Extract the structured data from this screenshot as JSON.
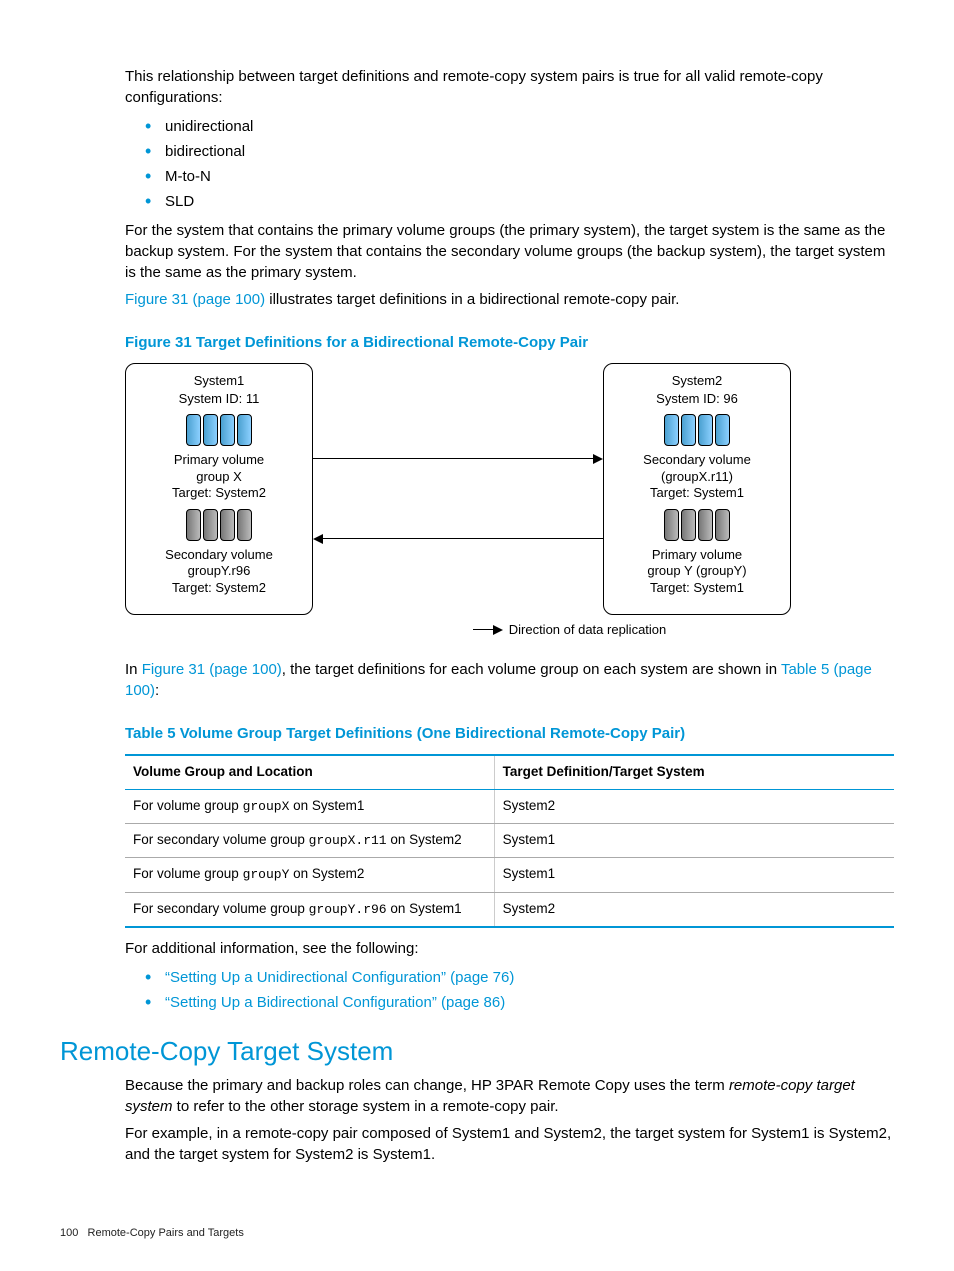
{
  "intro_para": "This relationship between target definitions and remote-copy system pairs is true for all valid remote-copy configurations:",
  "config_list": [
    "unidirectional",
    "bidirectional",
    "M-to-N",
    "SLD"
  ],
  "para2": "For the system that contains the primary volume groups (the primary system), the target system is the same as the backup system. For the system that contains the secondary volume groups (the backup system), the target system is the same as the primary system.",
  "para3_link": "Figure 31 (page 100)",
  "para3_rest": " illustrates target definitions in a bidirectional remote-copy pair.",
  "figure_caption": "Figure 31 Target Definitions for a Bidirectional Remote-Copy Pair",
  "diagram": {
    "left": {
      "name": "System1",
      "id": "System ID: 11",
      "vg1": {
        "l1": "Primary volume",
        "l2": "group X",
        "l3": "Target: System2",
        "color": "blue"
      },
      "vg2": {
        "l1": "Secondary volume",
        "l2": "groupY.r96",
        "l3": "Target: System2",
        "color": "grey"
      }
    },
    "right": {
      "name": "System2",
      "id": "System ID: 96",
      "vg1": {
        "l1": "Secondary volume",
        "l2": "(groupX.r11)",
        "l3": "Target: System1",
        "color": "blue"
      },
      "vg2": {
        "l1": "Primary volume",
        "l2": "group Y (groupY)",
        "l3": "Target: System1",
        "color": "grey"
      }
    },
    "legend": "Direction of data replication"
  },
  "para4_pre": "In ",
  "para4_link1": "Figure 31 (page 100)",
  "para4_mid": ", the target definitions for each volume group on each system are shown in ",
  "para4_link2": "Table 5 (page 100)",
  "para4_post": ":",
  "table_caption": "Table 5 Volume Group Target Definitions (One Bidirectional Remote-Copy Pair)",
  "table": {
    "h1": "Volume Group and Location",
    "h2": "Target Definition/Target System",
    "rows": [
      {
        "c1_pre": "For volume group ",
        "c1_code": "groupX",
        "c1_post": " on System1",
        "c2": "System2"
      },
      {
        "c1_pre": "For secondary volume group ",
        "c1_code": "groupX.r11",
        "c1_post": " on System2",
        "c2": "System1"
      },
      {
        "c1_pre": "For volume group ",
        "c1_code": "groupY",
        "c1_post": " on System2",
        "c2": "System1"
      },
      {
        "c1_pre": "For secondary volume group ",
        "c1_code": "groupY.r96",
        "c1_post": " on System1",
        "c2": "System2"
      }
    ]
  },
  "additional_info": "For additional information, see the following:",
  "see_links": [
    "“Setting Up a Unidirectional Configuration” (page 76)",
    "“Setting Up a Bidirectional Configuration” (page 86)"
  ],
  "h2": "Remote-Copy Target System",
  "para5_pre": "Because the primary and backup roles can change, HP 3PAR Remote Copy uses the term ",
  "para5_em": "remote-copy target system",
  "para5_post": " to refer to the other storage system in a remote-copy pair.",
  "para6": "For example, in a remote-copy pair composed of System1 and System2, the target system for System1 is System2, and the target system for System2 is System1.",
  "footer_page": "100",
  "footer_title": "Remote-Copy Pairs and Targets"
}
